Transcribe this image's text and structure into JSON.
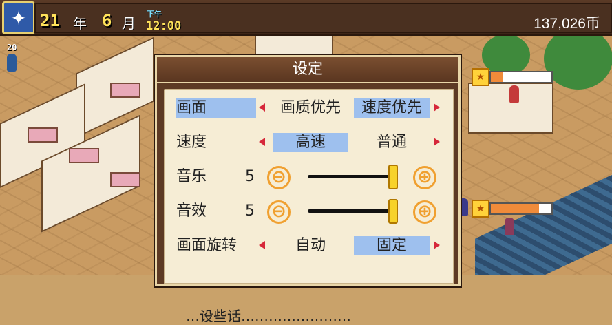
{
  "hud": {
    "year_value": "21",
    "year_unit": "年",
    "month_value": "6",
    "month_unit": "月",
    "ampm": "下午",
    "time": "12:00",
    "money": "137,026币",
    "gem_icon": "sparkle-gem-icon"
  },
  "staff_tag": "20",
  "dialog": {
    "title": "设定",
    "rows": [
      {
        "label": "画面",
        "options": [
          "画质优先",
          "速度优先"
        ],
        "selected": "速度优先"
      },
      {
        "label": "速度",
        "options": [
          "高速",
          "普通"
        ],
        "selected": "高速"
      },
      {
        "label": "音乐",
        "value": "5",
        "level": 1.0
      },
      {
        "label": "音效",
        "value": "5",
        "level": 1.0
      },
      {
        "label": "画面旋转",
        "options": [
          "自动",
          "固定"
        ],
        "selected": "固定"
      }
    ],
    "cut_text": "…设些话……………………"
  },
  "icons": {
    "minus": "⊖",
    "plus": "⊕"
  },
  "status_bars": [
    {
      "level": 0.2
    },
    {
      "level": 0.8
    }
  ],
  "colors": {
    "highlight": "#9ec0ee",
    "arrow": "#d6283a",
    "slider": "#f0a030",
    "gold_text": "#ffe25a"
  }
}
